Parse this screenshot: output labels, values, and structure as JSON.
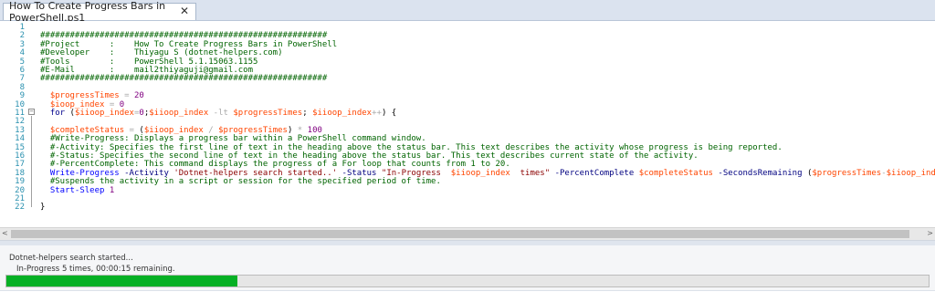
{
  "tab": {
    "title": "How To Create Progress Bars in PowerShell.ps1",
    "close": "✕"
  },
  "editor": {
    "line_numbers": [
      "1",
      "2",
      "3",
      "4",
      "5",
      "6",
      "7",
      "8",
      "9",
      "10",
      "11",
      "12",
      "13",
      "14",
      "15",
      "16",
      "17",
      "18",
      "19",
      "20",
      "21",
      "22"
    ],
    "lines": [
      [],
      [
        {
          "c": "cmt",
          "t": "##########################################################"
        }
      ],
      [
        {
          "c": "cmt",
          "t": "#Project      :    How To Create Progress Bars in PowerShell"
        }
      ],
      [
        {
          "c": "cmt",
          "t": "#Developer    :    Thiyagu S (dotnet-helpers.com)"
        }
      ],
      [
        {
          "c": "cmt",
          "t": "#Tools        :    PowerShell 5.1.15063.1155"
        }
      ],
      [
        {
          "c": "cmt",
          "t": "#E-Mail       :    mail2thiyaguji@gmail.com"
        }
      ],
      [
        {
          "c": "cmt",
          "t": "##########################################################"
        }
      ],
      [],
      [
        {
          "c": "var",
          "t": "  $progressTimes"
        },
        {
          "c": "op",
          "t": " = "
        },
        {
          "c": "num",
          "t": "20"
        }
      ],
      [
        {
          "c": "var",
          "t": "  $ioop_index"
        },
        {
          "c": "op",
          "t": " = "
        },
        {
          "c": "num",
          "t": "0"
        }
      ],
      [
        {
          "c": "kw",
          "t": "  for "
        },
        {
          "c": "plain",
          "t": "("
        },
        {
          "c": "var",
          "t": "$iioop_index"
        },
        {
          "c": "op",
          "t": "="
        },
        {
          "c": "num",
          "t": "0"
        },
        {
          "c": "plain",
          "t": ";"
        },
        {
          "c": "var",
          "t": "$iioop_index"
        },
        {
          "c": "op",
          "t": " -lt "
        },
        {
          "c": "var",
          "t": "$progressTimes"
        },
        {
          "c": "plain",
          "t": "; "
        },
        {
          "c": "var",
          "t": "$iioop_index"
        },
        {
          "c": "op",
          "t": "++"
        },
        {
          "c": "plain",
          "t": ") {"
        }
      ],
      [],
      [
        {
          "c": "var",
          "t": "  $completeStatus"
        },
        {
          "c": "op",
          "t": " = "
        },
        {
          "c": "plain",
          "t": "("
        },
        {
          "c": "var",
          "t": "$iioop_index"
        },
        {
          "c": "op",
          "t": " / "
        },
        {
          "c": "var",
          "t": "$progressTimes"
        },
        {
          "c": "plain",
          "t": ")"
        },
        {
          "c": "op",
          "t": " * "
        },
        {
          "c": "num",
          "t": "100"
        }
      ],
      [
        {
          "c": "cmt",
          "t": "  #Write-Progress: Displays a progress bar within a PowerShell command window."
        }
      ],
      [
        {
          "c": "cmt",
          "t": "  #-Activity: Specifies the first line of text in the heading above the status bar. This text describes the activity whose progress is being reported."
        }
      ],
      [
        {
          "c": "cmt",
          "t": "  #-Status: Specifies the second line of text in the heading above the status bar. This text describes current state of the activity."
        }
      ],
      [
        {
          "c": "cmt",
          "t": "  #-PercentComplete: This command displays the progress of a For loop that counts from 1 to 20."
        }
      ],
      [
        {
          "c": "cmd",
          "t": "  Write-Progress"
        },
        {
          "c": "param",
          "t": " -Activity "
        },
        {
          "c": "str",
          "t": "'Dotnet-helpers search started..'"
        },
        {
          "c": "param",
          "t": " -Status "
        },
        {
          "c": "str",
          "t": "\"In-Progress  "
        },
        {
          "c": "var",
          "t": "$iioop_index"
        },
        {
          "c": "str",
          "t": "  times\""
        },
        {
          "c": "param",
          "t": " -PercentComplete "
        },
        {
          "c": "var",
          "t": "$completeStatus"
        },
        {
          "c": "param",
          "t": " -SecondsRemaining "
        },
        {
          "c": "plain",
          "t": "("
        },
        {
          "c": "var",
          "t": "$progressTimes"
        },
        {
          "c": "op",
          "t": "-"
        },
        {
          "c": "var",
          "t": "$iioop_index"
        },
        {
          "c": "plain",
          "t": ")"
        }
      ],
      [
        {
          "c": "cmt",
          "t": "  #Suspends the activity in a script or session for the specified period of time."
        }
      ],
      [
        {
          "c": "cmd",
          "t": "  Start-Sleep"
        },
        {
          "c": "num",
          "t": " 1"
        }
      ],
      [],
      [
        {
          "c": "plain",
          "t": "}"
        }
      ]
    ]
  },
  "scrollbar": {
    "left_arrow": "<",
    "right_arrow": ">"
  },
  "progress": {
    "activity": "Dotnet-helpers search started...",
    "status": "In-Progress  5  times, 00:00:15 remaining.",
    "percent_complete": 25,
    "fill_color": "#06b025"
  }
}
